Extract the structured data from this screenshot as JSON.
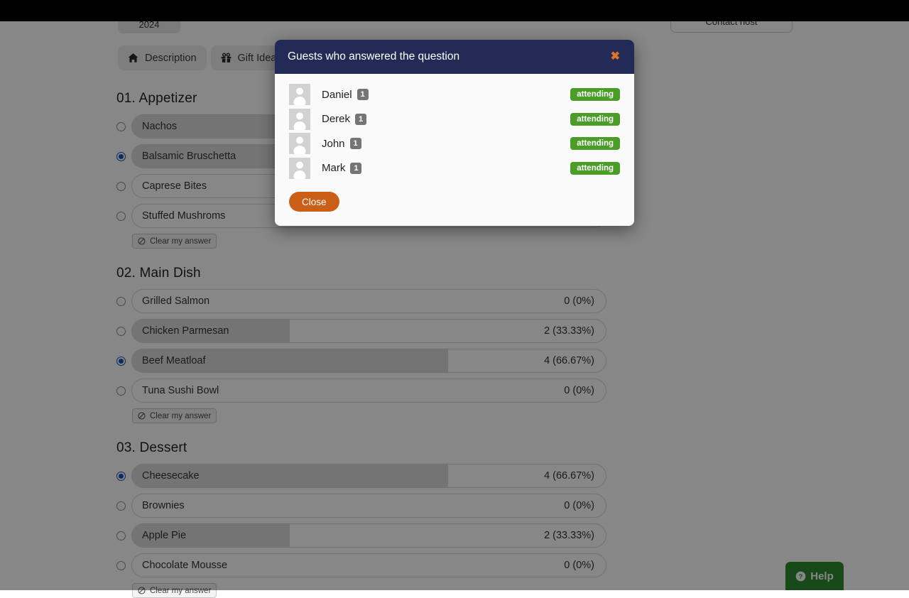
{
  "topbar": {
    "year_pill": "2024",
    "contact_host": "Contact host"
  },
  "tabs": [
    {
      "label": "Description",
      "icon": "home-icon"
    },
    {
      "label": "Gift Ideas",
      "icon": "gift-icon"
    }
  ],
  "clear_answer_label": "Clear my answer",
  "help": {
    "label": "Help",
    "icon": "question-circle-icon",
    "color": "#2e8b2e"
  },
  "sections": [
    {
      "title": "01. Appetizer",
      "options": [
        {
          "label": "Nachos",
          "count": "",
          "percent_text": "",
          "percent": 100,
          "selected": false
        },
        {
          "label": "Balsamic Bruschetta",
          "count": "",
          "percent_text": "",
          "percent": 100,
          "selected": true
        },
        {
          "label": "Caprese Bites",
          "count": "",
          "percent_text": "",
          "percent": 0,
          "selected": false
        },
        {
          "label": "Stuffed Mushroms",
          "count": "",
          "percent_text": "",
          "percent": 0,
          "selected": false
        }
      ]
    },
    {
      "title": "02. Main Dish",
      "options": [
        {
          "label": "Grilled Salmon",
          "count": 0,
          "percent_text": "0 (0%)",
          "percent": 0,
          "selected": false
        },
        {
          "label": "Chicken Parmesan",
          "count": 2,
          "percent_text": "2 (33.33%)",
          "percent": 33.33,
          "selected": false
        },
        {
          "label": "Beef Meatloaf",
          "count": 4,
          "percent_text": "4 (66.67%)",
          "percent": 66.67,
          "selected": true
        },
        {
          "label": "Tuna Sushi Bowl",
          "count": 0,
          "percent_text": "0 (0%)",
          "percent": 0,
          "selected": false
        }
      ]
    },
    {
      "title": "03. Dessert",
      "options": [
        {
          "label": "Cheesecake",
          "count": 4,
          "percent_text": "4 (66.67%)",
          "percent": 66.67,
          "selected": true
        },
        {
          "label": "Brownies",
          "count": 0,
          "percent_text": "0 (0%)",
          "percent": 0,
          "selected": false
        },
        {
          "label": "Apple Pie",
          "count": 2,
          "percent_text": "2 (33.33%)",
          "percent": 33.33,
          "selected": false
        },
        {
          "label": "Chocolate Mousse",
          "count": 0,
          "percent_text": "0 (0%)",
          "percent": 0,
          "selected": false
        }
      ]
    }
  ],
  "modal": {
    "title": "Guests who answered the question",
    "close_icon": "close-x-icon",
    "header_color": "#222b55",
    "close_label": "Close",
    "close_color": "#cc5f18",
    "status_color": "#4a9e28",
    "guests": [
      {
        "name": "Daniel",
        "count": "1",
        "status": "attending"
      },
      {
        "name": "Derek",
        "count": "1",
        "status": "attending"
      },
      {
        "name": "John",
        "count": "1",
        "status": "attending"
      },
      {
        "name": "Mark",
        "count": "1",
        "status": "attending"
      }
    ]
  }
}
